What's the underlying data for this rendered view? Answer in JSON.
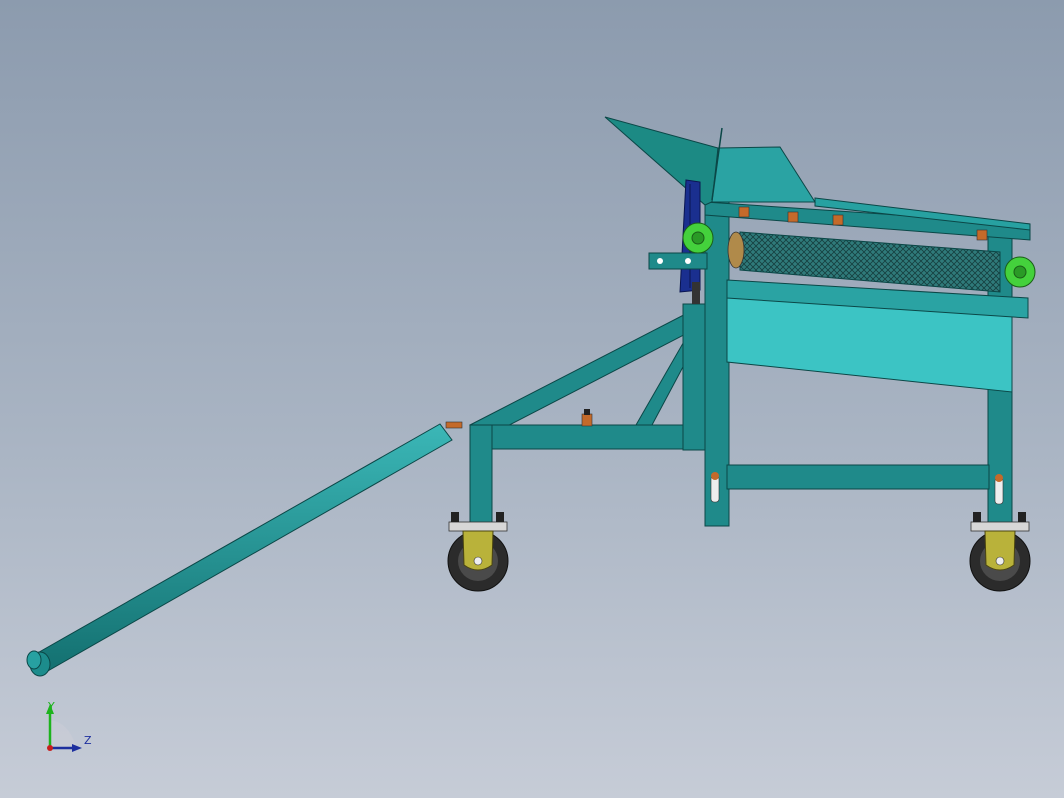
{
  "view": {
    "background_top": "#8c9bae",
    "background_bottom": "#c6ccd7"
  },
  "model": {
    "colors": {
      "frame": "#1f8a8a",
      "frame_dark": "#0f5f5f",
      "panel_light": "#3cc4c4",
      "drum_mesh": "#2a6f6f",
      "knob": "#44d13c",
      "wheel_bracket": "#b9b23a",
      "tire": "#2b2b2b",
      "pulley": "#1a2f8f",
      "bolt": "#2a2a2a",
      "copper": "#c46a2a"
    },
    "parts": [
      "hopper",
      "sieve-drum",
      "frame",
      "tow-bar",
      "caster-wheels",
      "adjuster-knobs",
      "drive-pulley"
    ]
  },
  "triad": {
    "y_label": "Y",
    "z_label": "Z",
    "y_color": "#1db31d",
    "z_color": "#1d2f9e",
    "origin_color": "#c81e1e"
  }
}
